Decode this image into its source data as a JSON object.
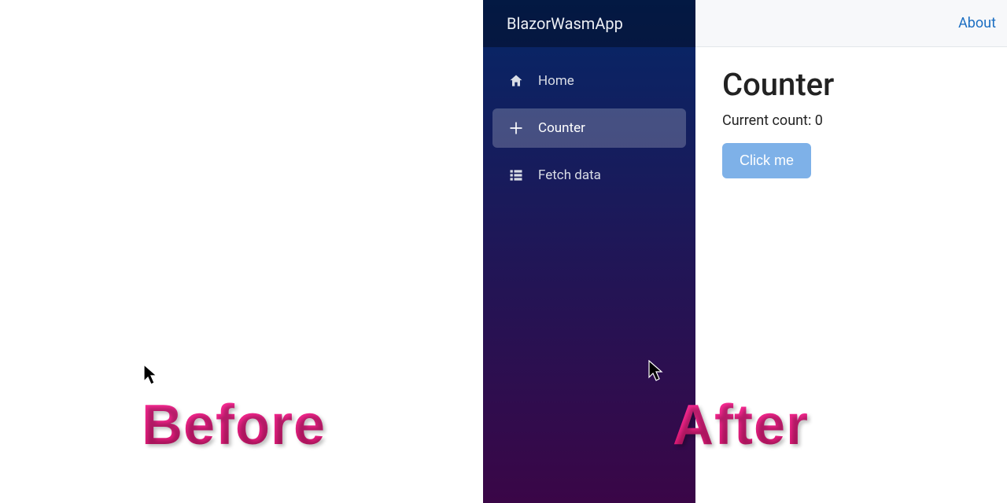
{
  "overlay": {
    "before": "Before",
    "after": "After"
  },
  "brand": "BlazorWasmApp",
  "topbar": {
    "about": "About"
  },
  "nav": {
    "items": [
      {
        "label": "Home"
      },
      {
        "label": "Counter"
      },
      {
        "label": "Fetch data"
      }
    ]
  },
  "counter": {
    "title": "Counter",
    "current_label": "Current count: 0",
    "button": "Click me"
  }
}
